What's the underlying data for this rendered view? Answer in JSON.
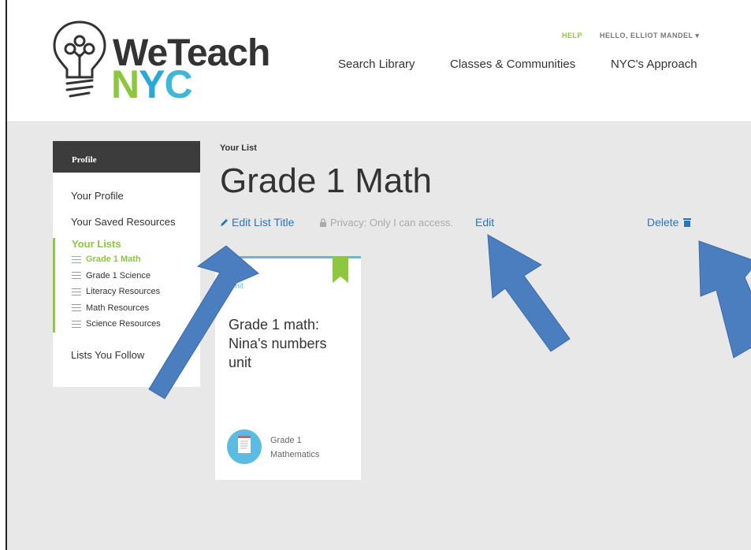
{
  "header": {
    "logo": {
      "we_text": "WeTeach",
      "nyc_n": "N",
      "nyc_y": "Y",
      "nyc_c": "C"
    },
    "help": "HELP",
    "user": "HELLO, ELLIOT MANDEL ▾",
    "nav": [
      "Search Library",
      "Classes & Communities",
      "NYC's Approach"
    ]
  },
  "sidebar": {
    "heading": "Profile",
    "your_profile": "Your Profile",
    "saved_resources": "Your Saved Resources",
    "your_lists": "Your Lists",
    "lists": [
      {
        "label": "Grade 1 Math",
        "active": true
      },
      {
        "label": "Grade 1 Science",
        "active": false
      },
      {
        "label": "Literacy Resources",
        "active": false
      },
      {
        "label": "Math Resources",
        "active": false
      },
      {
        "label": "Science Resources",
        "active": false
      }
    ],
    "lists_follow": "Lists You Follow"
  },
  "main": {
    "eyebrow": "Your List",
    "title": "Grade 1 Math",
    "edit_title": "Edit List Title",
    "privacy": "Privacy: Only I can access.",
    "edit_privacy": "Edit",
    "delete": "Delete"
  },
  "card": {
    "type": "Unit",
    "title": "Grade 1 math: Nina's numbers unit",
    "grade": "Grade 1",
    "subject": "Mathematics"
  },
  "icons": [
    "bulb-logo-icon",
    "pencil-icon",
    "lock-icon",
    "trash-icon",
    "list-icon",
    "bookmark-icon",
    "document-icon"
  ],
  "colors": {
    "green": "#8dc63f",
    "blue": "#2c74b8",
    "card_accent": "#5bbbe0",
    "annotation_arrow": "#4a7ebf"
  }
}
